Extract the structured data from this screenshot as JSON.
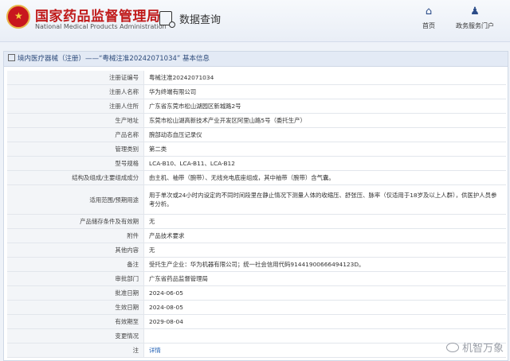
{
  "header": {
    "site_title": "国家药品监督管理局",
    "site_subtitle": "National Medical Products Administration",
    "section_title": "数据查询",
    "nav": [
      {
        "label": "首页",
        "icon": "home-icon"
      },
      {
        "label": "政务服务门户",
        "icon": "user-icon"
      }
    ]
  },
  "breadcrumb": "境内医疗器械（注册）——“粤械注准20242071034” 基本信息",
  "fields": [
    {
      "label": "注册证编号",
      "value": "粤械注准20242071034"
    },
    {
      "label": "注册人名称",
      "value": "华为终端有限公司"
    },
    {
      "label": "注册人住所",
      "value": "广东省东莞市松山湖园区新城路2号"
    },
    {
      "label": "生产地址",
      "value": "东莞市松山湖高新技术产业开发区阿里山路5号（委托生产）"
    },
    {
      "label": "产品名称",
      "value": "腕部动态血压记录仪"
    },
    {
      "label": "管理类别",
      "value": "第二类"
    },
    {
      "label": "型号规格",
      "value": "LCA-B10、LCA-B11、LCA-B12"
    },
    {
      "label": "结构及组成/主要组成成分",
      "value": "由主机、袖带（腕带）、无线充电底座组成，其中袖带（腕带）含气囊。"
    },
    {
      "label": "适用范围/预期用途",
      "value": "用于单次或24小时内设定的不同时间段里在静止情况下测量人体的收缩压、舒张压、脉率（仅适用于18岁及以上人群），供医护人员参考分析。"
    },
    {
      "label": "产品储存条件及有效期",
      "value": "无"
    },
    {
      "label": "附件",
      "value": "产品技术要求"
    },
    {
      "label": "其他内容",
      "value": "无"
    },
    {
      "label": "备注",
      "value": "受托生产企业：华为机器有限公司；统一社会信用代码91441900666494123D。"
    },
    {
      "label": "审批部门",
      "value": "广东省药品监督管理局"
    },
    {
      "label": "批准日期",
      "value": "2024-06-05"
    },
    {
      "label": "生效日期",
      "value": "2024-08-05"
    },
    {
      "label": "有效期至",
      "value": "2029-08-04"
    },
    {
      "label": "变更情况",
      "value": ""
    },
    {
      "label": "注",
      "value": "详情"
    }
  ],
  "watermark": "机智万象"
}
